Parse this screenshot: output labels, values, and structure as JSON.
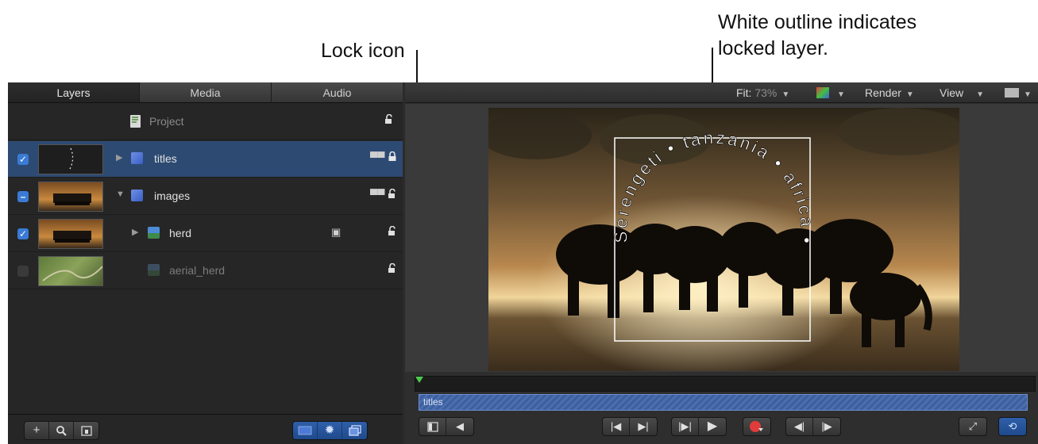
{
  "annotations": {
    "lock_icon": "Lock icon",
    "white_outline_line1": "White outline indicates",
    "white_outline_line2": "locked layer."
  },
  "tabs": [
    "Layers",
    "Media",
    "Audio"
  ],
  "layers": {
    "project": {
      "name": "Project"
    },
    "rows": [
      {
        "name": "titles",
        "checked": true,
        "expanded": false,
        "selected": true,
        "locked": true
      },
      {
        "name": "images",
        "checked": "mixed",
        "expanded": true,
        "selected": false,
        "locked": false
      },
      {
        "name": "herd",
        "checked": true,
        "expanded": false,
        "selected": false,
        "locked": false
      },
      {
        "name": "aerial_herd",
        "checked": false,
        "expanded": false,
        "selected": false,
        "locked": false
      }
    ]
  },
  "canvas_toolbar": {
    "fit_label": "Fit:",
    "fit_value": "73%",
    "render_label": "Render",
    "view_label": "View"
  },
  "canvas_text": {
    "arc_text": "Serengeti • tanzania • africa •"
  },
  "timeline": {
    "track_label": "titles"
  },
  "colors": {
    "selection": "#2d4a72",
    "checkbox": "#3a7bd5",
    "track": "#4a6eb0"
  },
  "icons": [
    "add-icon",
    "search-icon",
    "panel-icon",
    "lock-icon",
    "unlock-icon",
    "group-icon",
    "image-icon",
    "play-icon",
    "record-icon",
    "loop-icon",
    "fullscreen-icon",
    "speaker-icon"
  ]
}
